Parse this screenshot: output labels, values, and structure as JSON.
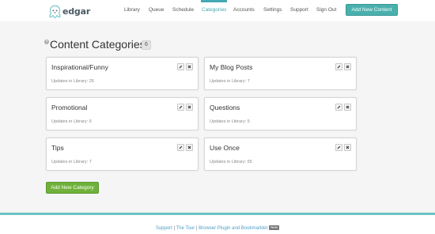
{
  "header": {
    "logo_text": "edgar",
    "nav": [
      {
        "label": "Library"
      },
      {
        "label": "Queue"
      },
      {
        "label": "Schedule"
      },
      {
        "label": "Categories",
        "active": true
      },
      {
        "label": "Accounts"
      },
      {
        "label": "Settings"
      },
      {
        "label": "Support"
      },
      {
        "label": "Sign Out"
      }
    ],
    "add_content_label": "Add New Content"
  },
  "page": {
    "help_icon": "?",
    "title": "Content Categories",
    "count": "6"
  },
  "categories": [
    {
      "name": "Inspirational/Funny",
      "updates": "Updates in Library: 26"
    },
    {
      "name": "My Blog Posts",
      "updates": "Updates in Library: 7"
    },
    {
      "name": "Promotional",
      "updates": "Updates in Library: 6"
    },
    {
      "name": "Questions",
      "updates": "Updates in Library: 5"
    },
    {
      "name": "Tips",
      "updates": "Updates in Library: 7"
    },
    {
      "name": "Use Once",
      "updates": "Updates in Library: 55"
    }
  ],
  "add_category_label": "Add New Category",
  "footer": {
    "support": "Support",
    "sep1": " | ",
    "tour": "The Tour",
    "sep2": " | ",
    "plugin": "Browser Plugin and Bookmarklet",
    "badge": "New"
  },
  "colors": {
    "accent": "#45a8b3",
    "add_content_button": "#4ab0ad",
    "add_category_button": "#6fb13a",
    "footer_stripe": "#6ec3c6"
  },
  "icons": {
    "card_edit": "pencil-icon",
    "card_delete": "close-icon"
  }
}
